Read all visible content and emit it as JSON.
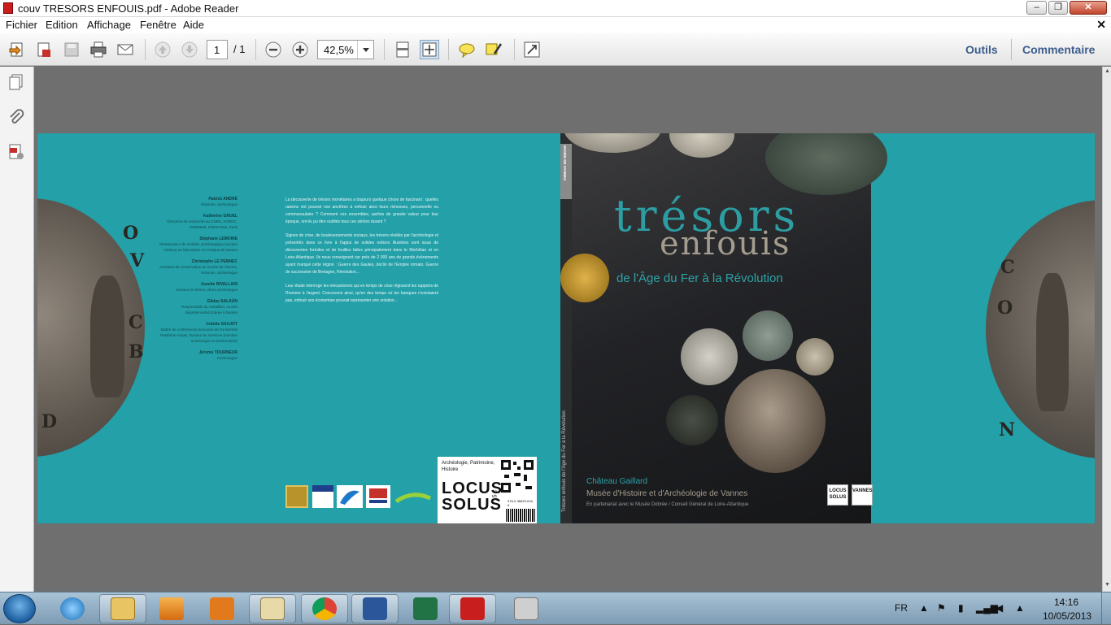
{
  "window": {
    "title": "couv TRESORS ENFOUIS.pdf - Adobe Reader",
    "min_label": "▭",
    "max_label": "□",
    "close_label": "✕"
  },
  "menu": {
    "items": [
      "Fichier",
      "Edition",
      "Affichage",
      "Fenêtre",
      "Aide"
    ],
    "close": "✕"
  },
  "toolbar": {
    "page_current": "1",
    "page_total": "/ 1",
    "zoom": "42,5%",
    "tools_label": "Outils",
    "comment_label": "Commentaire"
  },
  "document": {
    "authors": [
      {
        "name": "Patrick ANDRÉ",
        "role": "Historien, archéologue"
      },
      {
        "name": "Katherine GRUEL",
        "role": "Directrice de recherche au CNRS, AOROC, UMR8546, CNRS-ENS, Paris"
      },
      {
        "name": "Stéphane LEMOINE",
        "role": "Restaurateur de mobilier archéologique (section métaux) au laboratoire Arc'Antique de Nantes"
      },
      {
        "name": "Christophe LE PENNEC",
        "role": "Assistant de conservation au musée de Vannes, Historien, archéologue"
      },
      {
        "name": "Josette RIVALLAIN",
        "role": "Docteur ès-lettres, ethno-archéologue"
      },
      {
        "name": "Gildas SALAÜN",
        "role": "Responsable du médaillier, musée départemental Dobrée à Nantes"
      },
      {
        "name": "Colette SAUJOT",
        "role": "Maître de conférences honoraire de l'Université Panthéon-Assas, Docteur ès sciences (mention archéologie et archéométrie)"
      },
      {
        "name": "Jérome TOURNEUR",
        "role": "Archéologue"
      }
    ],
    "back_paragraphs": [
      "La découverte de trésors monétaires a toujours quelque chose de fascinant : quelles raisons ont poussé nos ancêtres à enfouir ainsi leurs richesses, personnelle ou communautaire ? Comment ces ensembles, parfois de grande valeur pour leur époque, ont-ils pu être oubliés tous ces siècles durant ?",
      "Signes de crise, de bouleversements sociaux, les trésors révélés par l'archéologie et présentés dans ce livre à l'appui de solides notices illustrées sont issus de découvertes fortuites et de fouilles faites principalement dans le Morbihan et en Loire-Atlantique. Ils nous renseignent sur près de 2 000 ans de grands événements ayant marqué cette région : Guerre des Gaules, déclin de l'Empire romain, Guerre de succession de Bretagne, Révolution...",
      "Leur étude interroge les mécanismes qui en temps de crise régissent les rapports de l'homme à l'argent. Concevons ainsi, qu'en des temps où les banques n'existaient pas, enfouir ses économies pouvait représenter une solution..."
    ],
    "barcode": {
      "category": "Archéologie, Patrimoine, Histoire",
      "publisher_1": "LOCUS",
      "publisher_2": "SOLUS",
      "price": "15 €",
      "isbn": "978-2-36833-016-6"
    },
    "spine": {
      "museum": "MUSÉE DE VANNES",
      "title": "Trésors enfouis de l'Âge du Fer à la Révolution"
    },
    "front": {
      "title_1": "trésors",
      "title_2": "enfouis",
      "subtitle": "de l'Âge du Fer à la Révolution",
      "venue_1": "Château Gaillard",
      "venue_2": "Musée d'Histoire et d'Archéologie de Vannes",
      "partner": "En partenariat avec le Musée Dobrée / Conseil Général de Loire-Atlantique",
      "logo_1": "LOCUS SOLUS",
      "logo_2": "VANNES"
    },
    "coin_letters_left": [
      "O",
      "V",
      "C",
      "B",
      "D"
    ],
    "coin_letters_right": [
      "O",
      "C",
      "N"
    ]
  },
  "taskbar": {
    "lang": "FR",
    "time": "14:16",
    "date": "10/05/2013"
  }
}
